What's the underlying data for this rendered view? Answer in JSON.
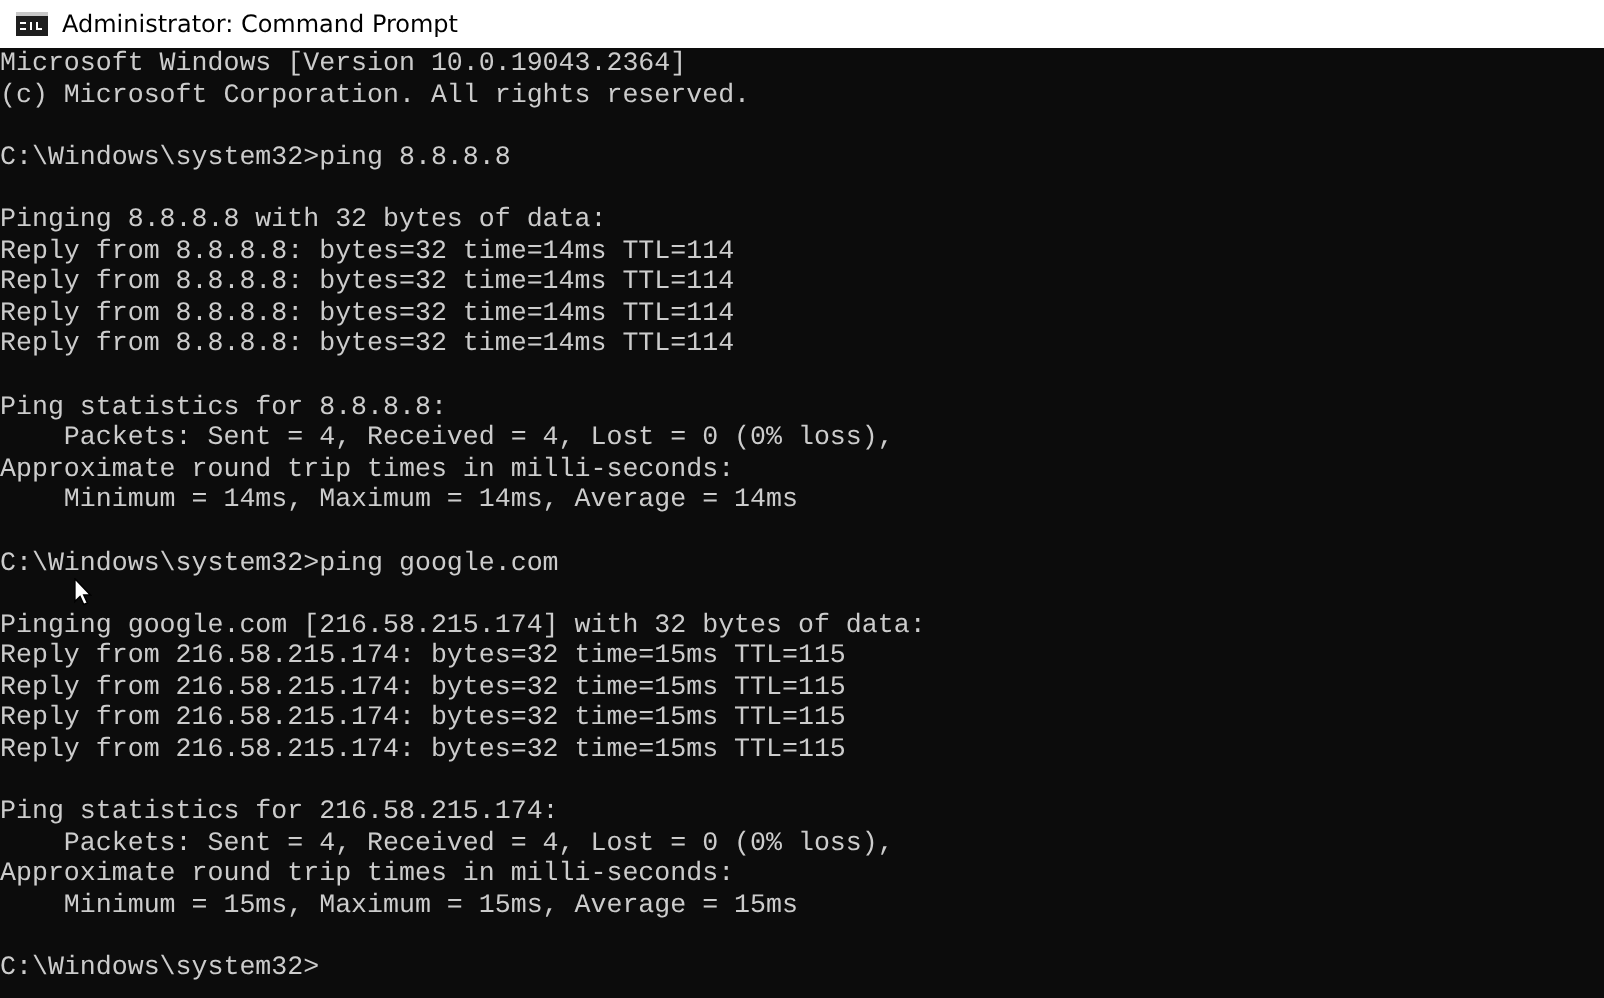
{
  "window": {
    "title": "Administrator: Command Prompt"
  },
  "console": {
    "blocks": [
      [
        "Microsoft Windows [Version 10.0.19043.2364]",
        "(c) Microsoft Corporation. All rights reserved."
      ],
      [
        "C:\\Windows\\system32>ping 8.8.8.8"
      ],
      [
        "Pinging 8.8.8.8 with 32 bytes of data:",
        "Reply from 8.8.8.8: bytes=32 time=14ms TTL=114",
        "Reply from 8.8.8.8: bytes=32 time=14ms TTL=114",
        "Reply from 8.8.8.8: bytes=32 time=14ms TTL=114",
        "Reply from 8.8.8.8: bytes=32 time=14ms TTL=114"
      ],
      [
        "Ping statistics for 8.8.8.8:",
        "    Packets: Sent = 4, Received = 4, Lost = 0 (0% loss),",
        "Approximate round trip times in milli-seconds:",
        "    Minimum = 14ms, Maximum = 14ms, Average = 14ms"
      ],
      [
        "C:\\Windows\\system32>ping google.com"
      ],
      [
        "Pinging google.com [216.58.215.174] with 32 bytes of data:",
        "Reply from 216.58.215.174: bytes=32 time=15ms TTL=115",
        "Reply from 216.58.215.174: bytes=32 time=15ms TTL=115",
        "Reply from 216.58.215.174: bytes=32 time=15ms TTL=115",
        "Reply from 216.58.215.174: bytes=32 time=15ms TTL=115"
      ],
      [
        "Ping statistics for 216.58.215.174:",
        "    Packets: Sent = 4, Received = 4, Lost = 0 (0% loss),",
        "Approximate round trip times in milli-seconds:",
        "    Minimum = 15ms, Maximum = 15ms, Average = 15ms"
      ],
      [
        "C:\\Windows\\system32>"
      ]
    ]
  }
}
